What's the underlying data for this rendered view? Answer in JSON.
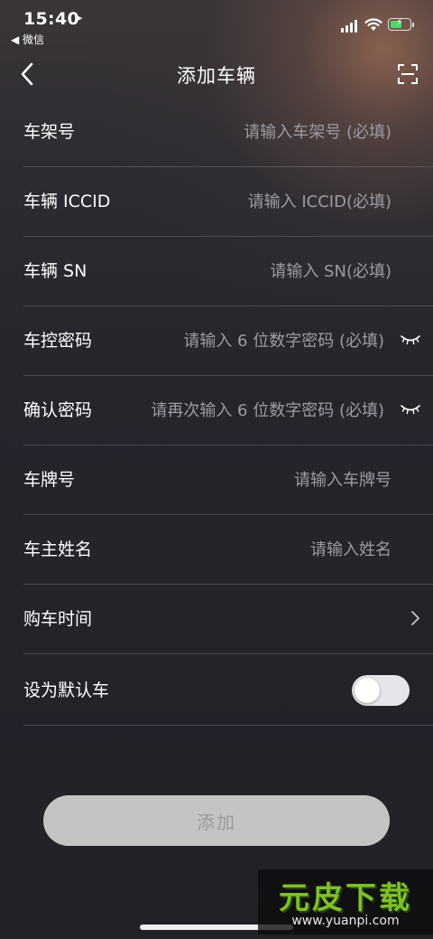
{
  "status_bar": {
    "time": "15:40",
    "back_app": "◀ 微信"
  },
  "nav": {
    "title": "添加车辆"
  },
  "form": {
    "rows": [
      {
        "label": "车架号",
        "placeholder": "请输入车架号 (必填)"
      },
      {
        "label": "车辆 ICCID",
        "placeholder": "请输入 ICCID(必填)"
      },
      {
        "label": "车辆 SN",
        "placeholder": "请输入 SN(必填)"
      },
      {
        "label": "车控密码",
        "placeholder": "请输入 6 位数字密码 (必填)",
        "icon": "eye-closed-icon"
      },
      {
        "label": "确认密码",
        "placeholder": "请再次输入 6 位数字密码 (必填)",
        "icon": "eye-closed-icon"
      },
      {
        "label": "车牌号",
        "placeholder": "请输入车牌号"
      },
      {
        "label": "车主姓名",
        "placeholder": "请输入姓名"
      },
      {
        "label": "购车时间",
        "icon": "chevron-right-icon"
      },
      {
        "label": "设为默认车",
        "toggle_on": false
      }
    ]
  },
  "submit": {
    "label": "添加",
    "background": "#c4c4c4",
    "text_color": "#9a9a9a"
  },
  "watermark": {
    "title": "元皮下载",
    "url": "www.yuanpi.com"
  },
  "colors": {
    "background": "#26252c",
    "placeholder": "#9c9ca4",
    "battery": "#4cd964",
    "watermark_green": "#7fbf2a"
  }
}
